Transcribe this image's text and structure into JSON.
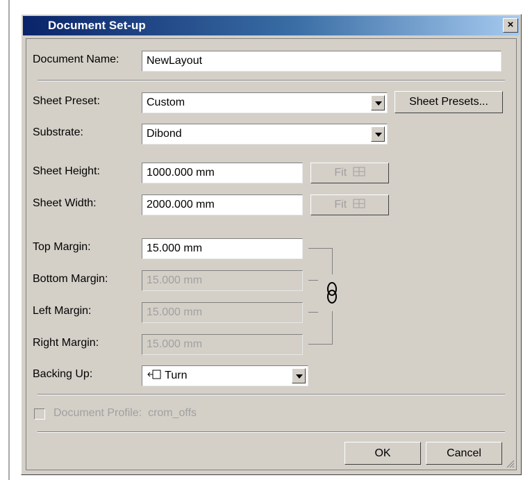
{
  "dialog": {
    "title": "Document Set-up",
    "close_glyph": "×"
  },
  "document_name": {
    "label": "Document Name:",
    "value": "NewLayout"
  },
  "sheet_preset": {
    "label": "Sheet Preset:",
    "value": "Custom",
    "button": "Sheet Presets..."
  },
  "substrate": {
    "label": "Substrate:",
    "value": "Dibond"
  },
  "sheet_height": {
    "label": "Sheet Height:",
    "value": "1000.000 mm",
    "fit": "Fit"
  },
  "sheet_width": {
    "label": "Sheet Width:",
    "value": "2000.000 mm",
    "fit": "Fit"
  },
  "margins": {
    "top": {
      "label": "Top Margin:",
      "value": "15.000 mm"
    },
    "bottom": {
      "label": "Bottom Margin:",
      "value": "15.000 mm"
    },
    "left": {
      "label": "Left Margin:",
      "value": "15.000 mm"
    },
    "right": {
      "label": "Right Margin:",
      "value": "15.000 mm"
    },
    "link_icon": "chain-link-icon"
  },
  "backing_up": {
    "label": "Backing Up:",
    "value": "Turn",
    "icon": "turn-icon"
  },
  "profile": {
    "label": "Document Profile:",
    "value": "crom_offs",
    "checked": false
  },
  "buttons": {
    "ok": "OK",
    "cancel": "Cancel"
  }
}
